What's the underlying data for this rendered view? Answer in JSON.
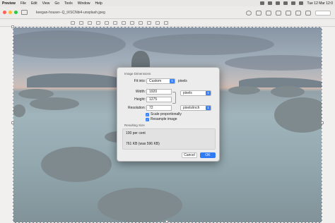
{
  "menubar": {
    "app": "Preview",
    "items": [
      "File",
      "Edit",
      "View",
      "Go",
      "Tools",
      "Window",
      "Help"
    ],
    "clock": "Tue 12 Mar 12:0"
  },
  "window": {
    "title": "keegan-houser--Q_tXSCNbi4-unsplash.jpeg"
  },
  "dialog": {
    "section_image": "Image Dimensions",
    "fit_into_label": "Fit into:",
    "fit_into_value": "Custom",
    "fit_into_unit": "pixels",
    "width_label": "Width:",
    "width_value": "1920",
    "height_label": "Height:",
    "height_value": "1275",
    "size_unit": "pixels",
    "resolution_label": "Resolution:",
    "resolution_value": "72",
    "resolution_unit": "pixels/inch",
    "scale_label": "Scale proportionally",
    "resample_label": "Resample image",
    "section_result": "Resulting Size",
    "result_percent": "100 per cent",
    "result_size": "761 KB (was 596 KB)",
    "cancel_label": "Cancel",
    "ok_label": "OK"
  },
  "colors": {
    "accent": "#2f7bf5",
    "close": "#ff5f57",
    "minimize": "#febc2e",
    "zoom": "#28c840"
  }
}
